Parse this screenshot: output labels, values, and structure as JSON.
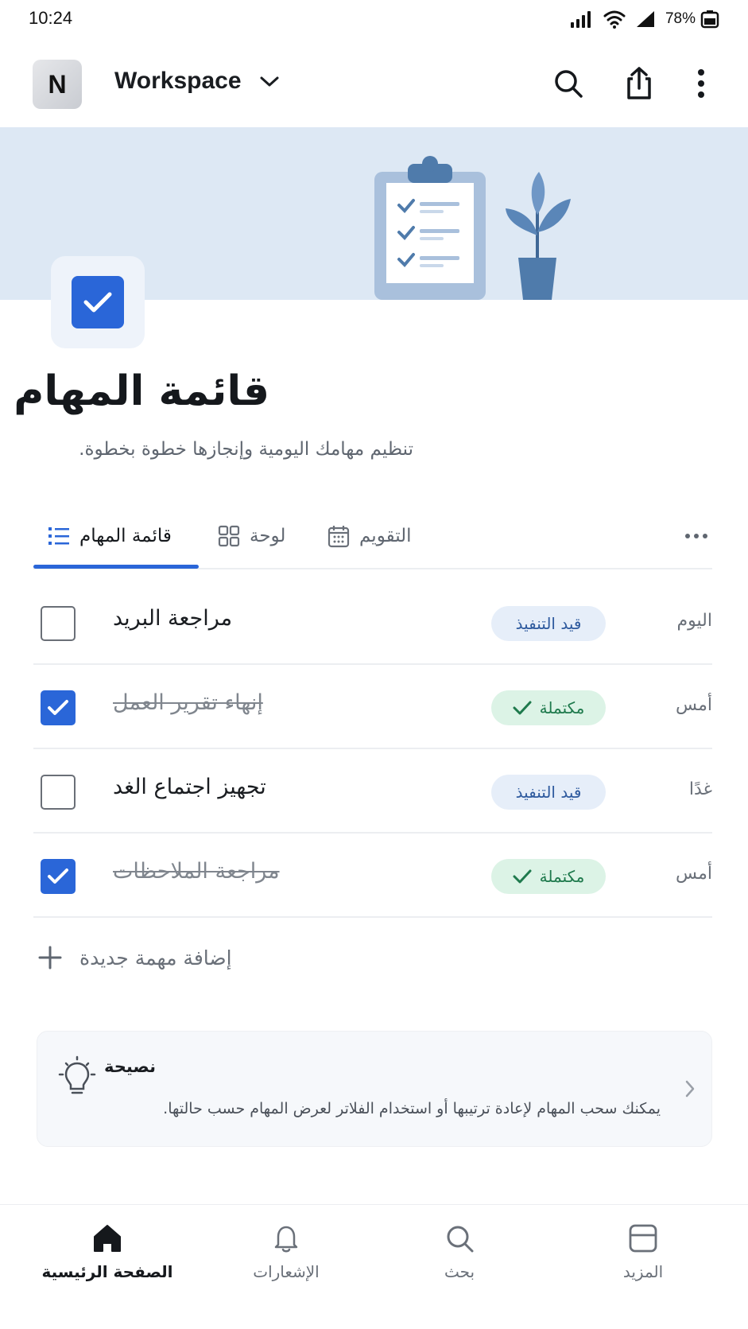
{
  "status_bar": {
    "time": "10:24",
    "battery": "78%"
  },
  "header": {
    "avatar_letter": "N",
    "workspace_name": "Workspace"
  },
  "page": {
    "title": "قائمة المهام",
    "subtitle": "تنظيم مهامك اليومية وإنجازها خطوة بخطوة."
  },
  "tabs": [
    {
      "label": "قائمة المهام",
      "active": true
    },
    {
      "label": "لوحة",
      "active": false
    },
    {
      "label": "التقويم",
      "active": false
    }
  ],
  "tasks": [
    {
      "title": "مراجعة البريد",
      "status": "قيد التنفيذ",
      "due": "اليوم",
      "done": false
    },
    {
      "title": "إنهاء تقرير العمل",
      "status": "مكتملة",
      "due": "أمس",
      "done": true
    },
    {
      "title": "تجهيز اجتماع الغد",
      "status": "قيد التنفيذ",
      "due": "غدًا",
      "done": false
    },
    {
      "title": "مراجعة الملاحظات",
      "status": "مكتملة",
      "due": "أمس",
      "done": true
    }
  ],
  "add_task_label": "إضافة مهمة جديدة",
  "tip": {
    "title": "نصيحة",
    "text": "يمكنك سحب المهام لإعادة ترتيبها أو استخدام الفلاتر لعرض المهام حسب حالتها."
  },
  "bottom_nav": [
    {
      "label": "الصفحة الرئيسية",
      "icon": "home-icon",
      "active": true
    },
    {
      "label": "الإشعارات",
      "icon": "bell-icon",
      "active": false
    },
    {
      "label": "بحث",
      "icon": "search-icon",
      "active": false
    },
    {
      "label": "المزيد",
      "icon": "more-box-icon",
      "active": false
    }
  ],
  "colors": {
    "accent": "#2a66d8",
    "cover": "#dde8f4",
    "badge_progress": "#e6eef9",
    "badge_done": "#dcf3e6"
  }
}
